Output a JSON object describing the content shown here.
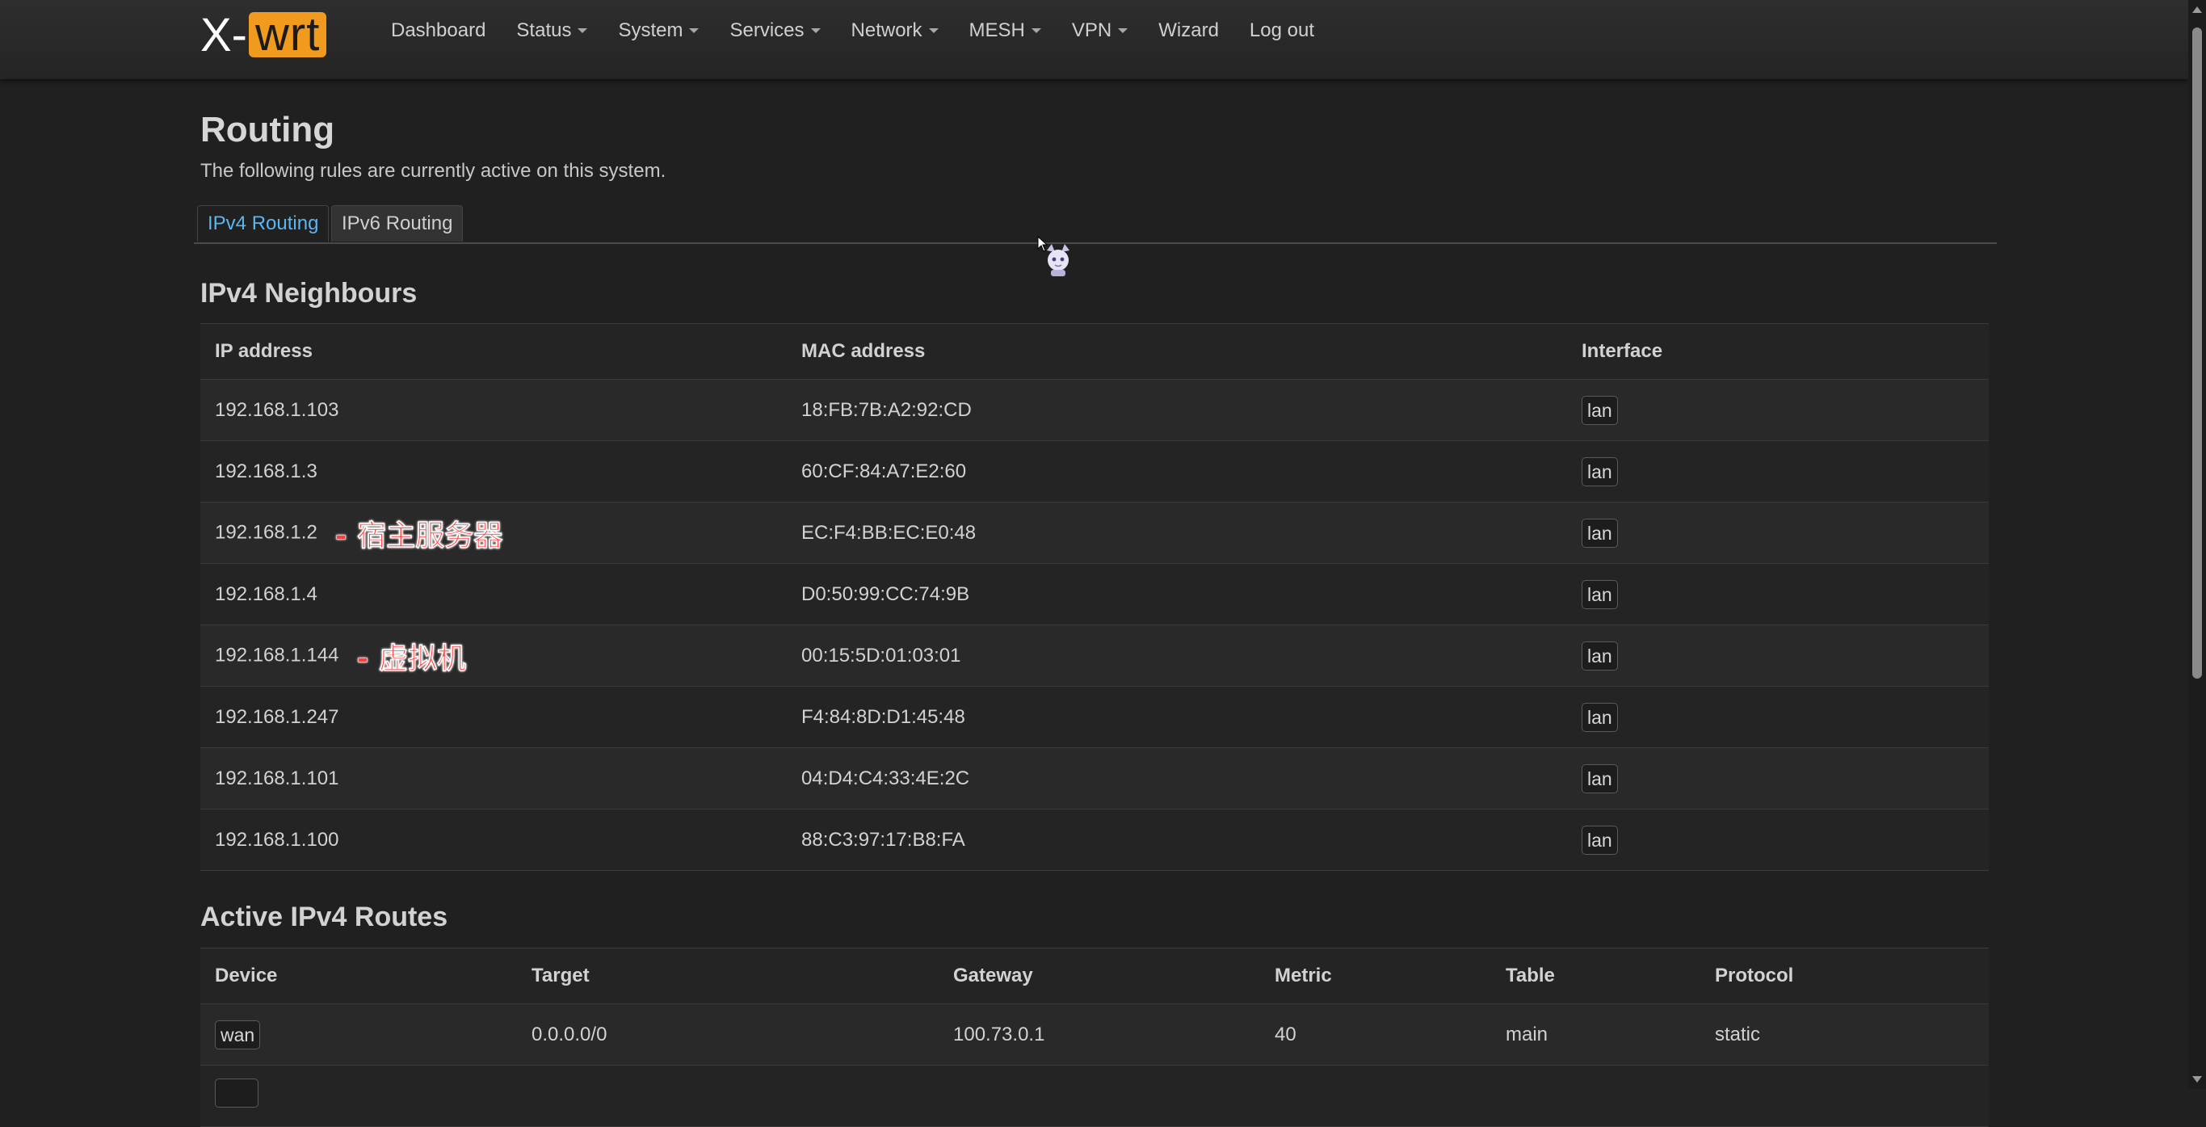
{
  "brand": {
    "prefix": "X-",
    "suffix": "wrt",
    "accent": "#f09a1e"
  },
  "nav": [
    {
      "label": "Dashboard",
      "dropdown": false
    },
    {
      "label": "Status",
      "dropdown": true
    },
    {
      "label": "System",
      "dropdown": true
    },
    {
      "label": "Services",
      "dropdown": true
    },
    {
      "label": "Network",
      "dropdown": true
    },
    {
      "label": "MESH",
      "dropdown": true
    },
    {
      "label": "VPN",
      "dropdown": true
    },
    {
      "label": "Wizard",
      "dropdown": false
    },
    {
      "label": "Log out",
      "dropdown": false
    }
  ],
  "page": {
    "title": "Routing",
    "description": "The following rules are currently active on this system."
  },
  "tabs": {
    "ipv4": "IPv4 Routing",
    "ipv6": "IPv6 Routing",
    "active": "ipv4"
  },
  "neighbours": {
    "title": "IPv4 Neighbours",
    "headers": {
      "ip": "IP address",
      "mac": "MAC address",
      "iface": "Interface"
    },
    "rows": [
      {
        "ip": "192.168.1.103",
        "mac": "18:FB:7B:A2:92:CD",
        "iface": "lan",
        "note": ""
      },
      {
        "ip": "192.168.1.3",
        "mac": "60:CF:84:A7:E2:60",
        "iface": "lan",
        "note": ""
      },
      {
        "ip": "192.168.1.2",
        "mac": "EC:F4:BB:EC:E0:48",
        "iface": "lan",
        "note": "- 宿主服务器"
      },
      {
        "ip": "192.168.1.4",
        "mac": "D0:50:99:CC:74:9B",
        "iface": "lan",
        "note": ""
      },
      {
        "ip": "192.168.1.144",
        "mac": "00:15:5D:01:03:01",
        "iface": "lan",
        "note": "- 虚拟机"
      },
      {
        "ip": "192.168.1.247",
        "mac": "F4:84:8D:D1:45:48",
        "iface": "lan",
        "note": ""
      },
      {
        "ip": "192.168.1.101",
        "mac": "04:D4:C4:33:4E:2C",
        "iface": "lan",
        "note": ""
      },
      {
        "ip": "192.168.1.100",
        "mac": "88:C3:97:17:B8:FA",
        "iface": "lan",
        "note": ""
      }
    ]
  },
  "routes": {
    "title": "Active IPv4 Routes",
    "headers": {
      "device": "Device",
      "target": "Target",
      "gateway": "Gateway",
      "metric": "Metric",
      "table": "Table",
      "protocol": "Protocol"
    },
    "rows": [
      {
        "device": "wan",
        "target": "0.0.0.0/0",
        "gateway": "100.73.0.1",
        "metric": "40",
        "table": "main",
        "protocol": "static"
      }
    ]
  }
}
